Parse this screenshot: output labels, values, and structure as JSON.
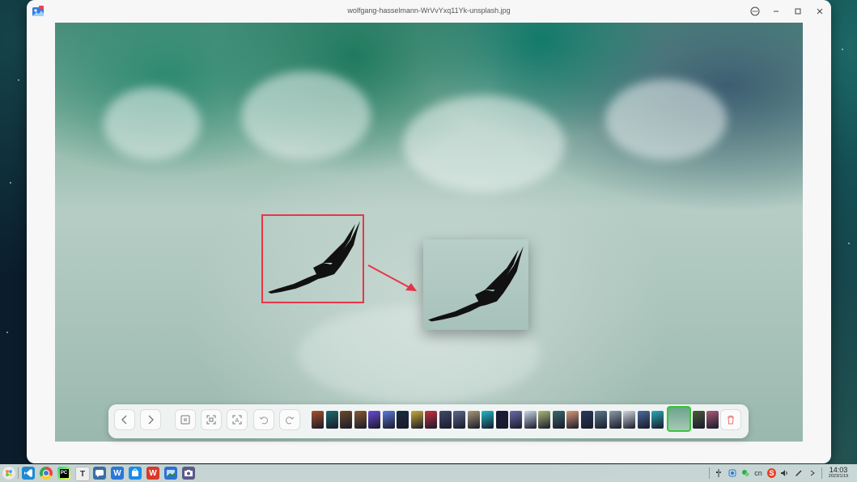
{
  "window": {
    "title": "wolfgang-hasselmann-WrVvYxq11Yk-unsplash.jpg",
    "icons": {
      "menu": "more-options-icon",
      "minimize": "minimize-icon",
      "maximize": "maximize-icon",
      "close": "close-icon"
    }
  },
  "toolbar": {
    "buttons": [
      "previous-icon",
      "next-icon",
      "original-size-icon",
      "fit-window-icon",
      "extract-text-icon",
      "rotate-left-icon",
      "rotate-right-icon",
      "delete-icon"
    ],
    "thumbnail_colors": [
      "#a8512a",
      "#1d6b6b",
      "#6b4a2a",
      "#8a5a30",
      "#6a4ad8",
      "#5a7ad8",
      "#1a2a3a",
      "#c8a838",
      "#c83040",
      "#404a6a",
      "#5a6a8a",
      "#a89878",
      "#20b8c8",
      "#1a1a3a",
      "#6a6aa8",
      "#c8d8e8",
      "#a8b878",
      "#3a6a6a",
      "#d89878",
      "#2a3a5a",
      "#5a7a8a",
      "#8a9aa8",
      "#d0d8e0",
      "#4a6a9a",
      "#2aa8b8",
      "#a8c8b8",
      "#4a5a3a",
      "#a85a7a"
    ],
    "current_index": 25
  },
  "taskbar": {
    "apps": [
      "launcher-icon",
      "vscode-icon",
      "chrome-icon",
      "pycharm-icon",
      "typora-icon",
      "chat-icon",
      "wps-icon",
      "app-store-icon",
      "wps-office-icon",
      "image-viewer-icon",
      "screenshot-icon"
    ],
    "tray": [
      "usb-icon",
      "clipboard-icon",
      "wechat-icon",
      "ime-icon",
      "sogou-icon",
      "volume-icon",
      "pen-icon",
      "expand-icon"
    ],
    "ime_label": "cn",
    "time": "14:03",
    "date": "2023/1/19"
  }
}
